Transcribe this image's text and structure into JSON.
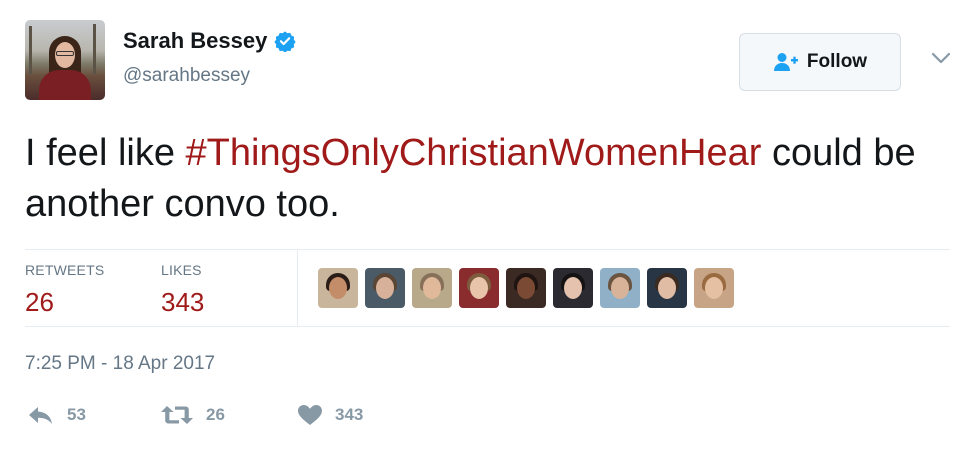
{
  "author": {
    "name": "Sarah Bessey",
    "handle": "@sarahbessey",
    "verified": true
  },
  "follow_button": {
    "label": "Follow",
    "icon": "add-user-icon"
  },
  "tweet": {
    "text_before": "I feel like ",
    "hashtag": "#ThingsOnlyChristianWomenHear",
    "text_after": " could be another convo too."
  },
  "stats": {
    "retweets_label": "RETWEETS",
    "retweets_value": "26",
    "likes_label": "LIKES",
    "likes_value": "343"
  },
  "likers": [
    {
      "name": "liker-1",
      "bg": "#c9b49c",
      "skin": "#c38d6a",
      "hair": "#2a1d17"
    },
    {
      "name": "liker-2",
      "bg": "#4a5a66",
      "skin": "#d7b199",
      "hair": "#5b4534"
    },
    {
      "name": "liker-3",
      "bg": "#b7a98a",
      "skin": "#e0b99b",
      "hair": "#86705a"
    },
    {
      "name": "liker-4",
      "bg": "#8a2b2e",
      "skin": "#e8c4aa",
      "hair": "#7d5b3d"
    },
    {
      "name": "liker-5",
      "bg": "#3b2a24",
      "skin": "#7a4a35",
      "hair": "#1f1410"
    },
    {
      "name": "liker-6",
      "bg": "#2a2a30",
      "skin": "#e4c2ad",
      "hair": "#151313"
    },
    {
      "name": "liker-7",
      "bg": "#8fb0c6",
      "skin": "#d8b39a",
      "hair": "#6b5440"
    },
    {
      "name": "liker-8",
      "bg": "#283544",
      "skin": "#e0bca4",
      "hair": "#3a2a20"
    },
    {
      "name": "liker-9",
      "bg": "#c7a486",
      "skin": "#e6c0a3",
      "hair": "#9a6a40"
    }
  ],
  "timestamp": "7:25 PM - 18 Apr 2017",
  "actions": {
    "reply_count": "53",
    "retweet_count": "26",
    "like_count": "343"
  },
  "colors": {
    "link": "#a01a1a",
    "verified": "#1da1f2",
    "muted": "#657786",
    "action_icon": "#8899a6"
  }
}
